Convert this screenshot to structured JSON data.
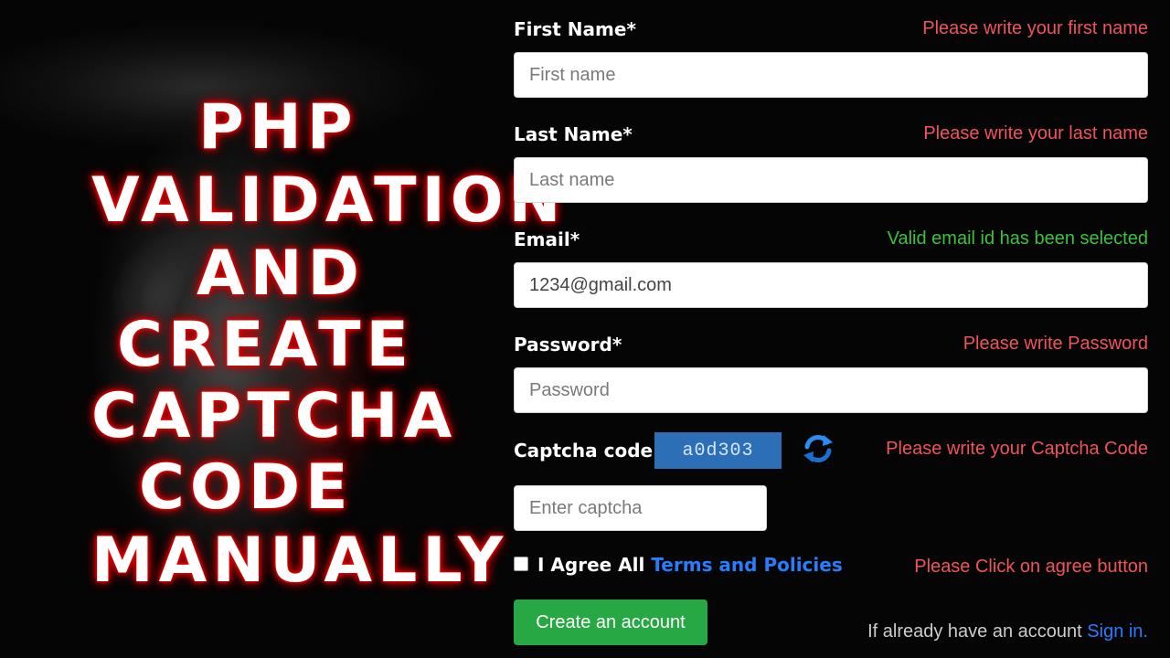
{
  "title_lines": [
    "PHP",
    "VALIDATION",
    "AND",
    "CREATE",
    "CAPTCHA",
    "CODE",
    "MANUALLY"
  ],
  "form": {
    "first_name": {
      "label": "First Name*",
      "message": "Please write your first name",
      "placeholder": "First name"
    },
    "last_name": {
      "label": "Last Name*",
      "message": "Please write your last name",
      "placeholder": "Last name"
    },
    "email": {
      "label": "Email*",
      "message": "Valid email id has been selected",
      "value": "1234@gmail.com"
    },
    "password": {
      "label": "Password*",
      "message": "Please write Password",
      "placeholder": "Password"
    },
    "captcha": {
      "label": "Captcha code",
      "code": "a0d303",
      "message": "Please write your Captcha Code",
      "placeholder": "Enter captcha",
      "refresh_icon": "refresh-icon"
    },
    "agree": {
      "text": "I Agree All",
      "link": "Terms and Policies",
      "message": "Please Click on agree button",
      "checked": false
    },
    "submit_label": "Create an account",
    "signin_text": "If already have an account",
    "signin_link": "Sign in."
  },
  "colors": {
    "error": "#f0545a",
    "success": "#3cc23c",
    "link": "#2a7cff",
    "button": "#28a745",
    "captcha_bg": "#2d6fb7",
    "title_glow": "#e00000"
  }
}
